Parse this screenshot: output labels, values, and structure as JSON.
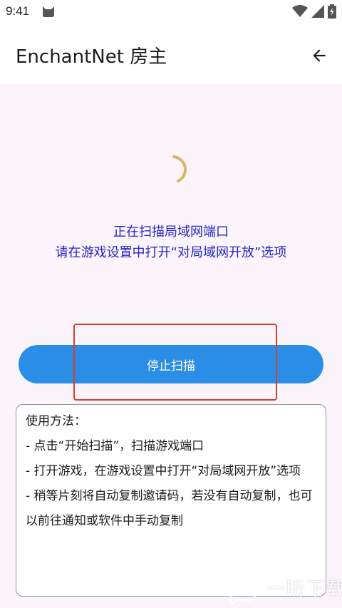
{
  "status_bar": {
    "time": "9:41",
    "icons": [
      "cat-icon",
      "wifi-icon",
      "signal-icon",
      "battery-icon"
    ]
  },
  "app_bar": {
    "title": "EnchantNet 房主",
    "back_icon": "arrow-back-icon"
  },
  "scan": {
    "status_line_1": "正在扫描局域网端口",
    "status_line_2": "请在游戏设置中打开“对局域网开放”选项",
    "stop_button_label": "停止扫描"
  },
  "instructions": {
    "lines": [
      "使用方法：",
      " - 点击“开始扫描”，扫描游戏端口",
      " - 打开游戏，在游戏设置中打开“对局域网开放”选项",
      " - 稍等片刻将自动复制邀请码，若没有自动复制，也可以前往通知或软件中手动复制"
    ]
  },
  "watermark": {
    "text": "一听下载"
  },
  "colors": {
    "primary_button": "#2a8de6",
    "status_text": "#2525c6",
    "spinner": "#d9b46a",
    "highlight": "#d8402e",
    "background": "#fbf4fb"
  }
}
